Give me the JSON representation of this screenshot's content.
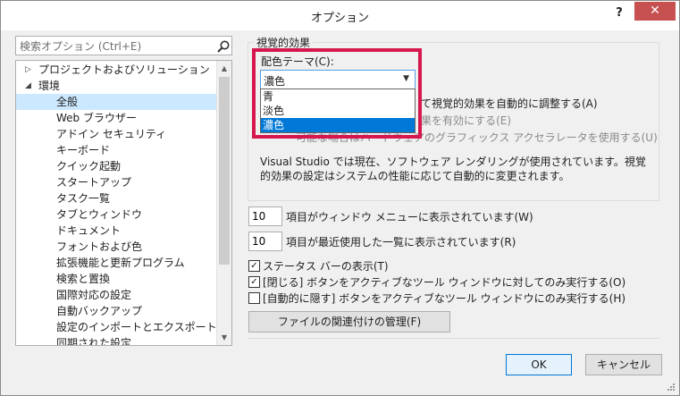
{
  "window": {
    "title": "オプション",
    "help_label": "?",
    "close_label": "✕"
  },
  "search": {
    "placeholder": "検索オプション (Ctrl+E)"
  },
  "tree": {
    "items": [
      {
        "label": "プロジェクトおよびソリューション",
        "arrow": "▷"
      },
      {
        "label": "環境",
        "arrow": "◢"
      },
      {
        "label": "全般"
      },
      {
        "label": "Web ブラウザー"
      },
      {
        "label": "アドイン セキュリティ"
      },
      {
        "label": "キーボード"
      },
      {
        "label": "クイック起動"
      },
      {
        "label": "スタートアップ"
      },
      {
        "label": "タスク一覧"
      },
      {
        "label": "タブとウィンドウ"
      },
      {
        "label": "ドキュメント"
      },
      {
        "label": "フォントおよび色"
      },
      {
        "label": "拡張機能と更新プログラム"
      },
      {
        "label": "検索と置換"
      },
      {
        "label": "国際対応の設定"
      },
      {
        "label": "自動バックアップ"
      },
      {
        "label": "設定のインポートとエクスポート"
      },
      {
        "label": "同期された設定"
      }
    ]
  },
  "visual_group": {
    "title": "視覚的効果",
    "scheme_label": "配色テーマ(C):",
    "scheme_value": "濃色",
    "scheme_options": [
      "青",
      "淡色",
      "濃色"
    ],
    "auto_adjust_label": "て視覚的効果を自動的に調整する(A)",
    "rich_client_label": "果を有効にする(E)",
    "hw_accel_label": "可能な場合はハードウェアのグラフィックス アクセラレータを使用する(U)",
    "description": "Visual Studio では現在、ソフトウェア レンダリングが使用されています。視覚的効果の設定はシステムの性能に応じて自動的に変更されます。"
  },
  "window_menu": {
    "value": "10",
    "label": "項目がウィンドウ メニューに表示されています(W)"
  },
  "mru": {
    "value": "10",
    "label": "項目が最近使用した一覧に表示されています(R)"
  },
  "checks": [
    {
      "label": "ステータス バーの表示(T)",
      "checked": "✓"
    },
    {
      "label": "[閉じる] ボタンをアクティブなツール ウィンドウに対してのみ実行する(O)",
      "checked": "✓"
    },
    {
      "label": "[自動的に隠す] ボタンをアクティブなツール ウィンドウにのみ実行する(H)",
      "checked": ""
    }
  ],
  "file_assoc_label": "ファイルの関連付けの管理(F)",
  "ok_label": "OK",
  "cancel_label": "キャンセル",
  "colors": {
    "highlight": "#d6174e",
    "selection": "#0078d7",
    "close": "#c75050"
  }
}
